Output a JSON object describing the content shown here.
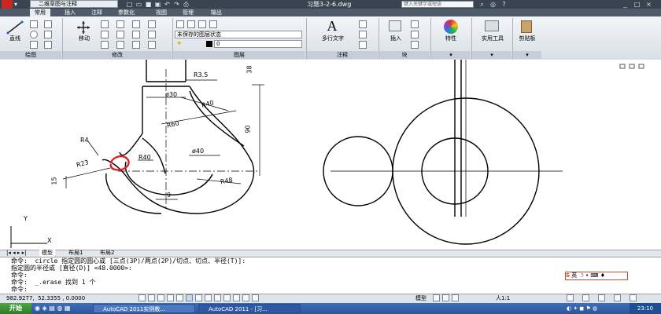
{
  "title_bar": {
    "workspace": "二维草图与注释",
    "doc_title": "习题3-2-6.dwg",
    "search_placeholder": "键入关键字或短语"
  },
  "ribbon_tabs": [
    "常用",
    "插入",
    "注释",
    "参数化",
    "视图",
    "管理",
    "输出"
  ],
  "ribbon": {
    "line_label": "直线",
    "move_label": "移动",
    "layer_state": "未保存的图层状态",
    "layer_current": "0",
    "multiline_text_label": "多行文字",
    "insert_label": "插入",
    "properties_label": "特性",
    "utilities_label": "实用工具",
    "clipboard_label": "剪贴板",
    "panels": [
      "绘图",
      "修改",
      "图层",
      "注释",
      "块"
    ]
  },
  "drawing": {
    "dims": {
      "r35": "R3.5",
      "d30": "ø30",
      "r40": "R40",
      "r60": "R60",
      "d40": "ø40",
      "r40b": "R40",
      "r4": "R4",
      "r23": "R23",
      "r48": "R48",
      "v90": "90",
      "v38": "38",
      "v15": "15",
      "v9": "9"
    },
    "ucs_x": "X",
    "ucs_y": "Y"
  },
  "layout_tabs": [
    "模型",
    "布局1",
    "布局2"
  ],
  "command_lines": [
    "命令:  circle 指定圆的圆心或 [三点(3P)/两点(2P)/切点、切点、半径(T)]:",
    "指定圆的半径或 [直径(D)] <48.0000>:",
    "命令:",
    "命令:  _.erase 找到 1 个",
    "命令:"
  ],
  "status_bar": {
    "coords": "982.9277,  52.3355 , 0.0000",
    "model": "模型",
    "scale": "人1:1"
  },
  "ime": {
    "label": "英"
  },
  "taskbar": {
    "start": "开始",
    "task1": "AutoCAD 2011实例教...",
    "task2": "AutoCAD 2011 - [习...",
    "clock": "23:10"
  },
  "colors": {
    "titlebar": "#3a4350",
    "taskbar": "#2c5598",
    "highlight_circle": "#e02020"
  }
}
